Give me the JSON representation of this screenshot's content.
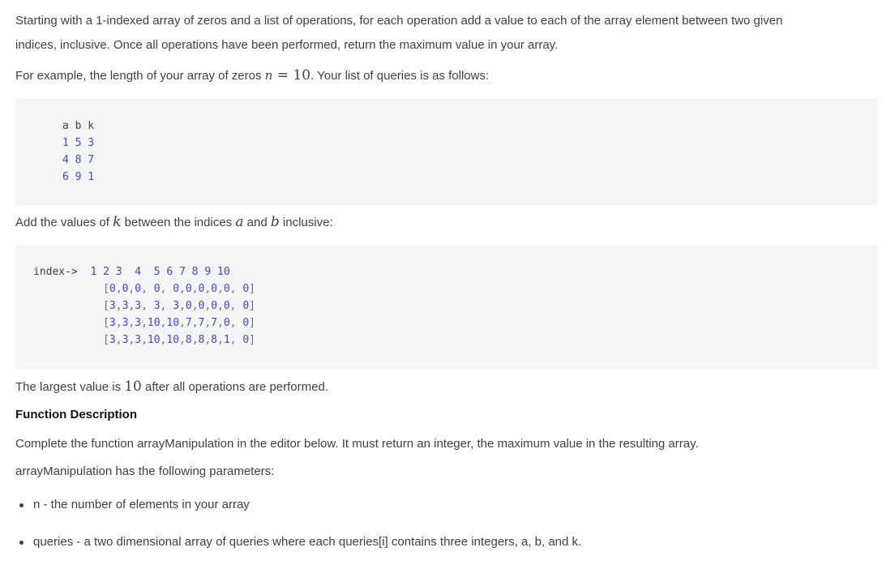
{
  "intro": {
    "line1": "Starting with a 1-indexed array of zeros and a list of operations, for each operation add a value to each of the array element between two given",
    "line2": "indices, inclusive. Once all operations have been performed, return the maximum value in your array.",
    "example_prefix": "For example, the length of your array of zeros ",
    "example_n": "n",
    "example_eq": " = ",
    "example_value": "10",
    "example_suffix": ". Your list of queries is as follows:"
  },
  "queries_block": {
    "header": "a b k",
    "rows": [
      "1 5 3",
      "4 8 7",
      "6 9 1"
    ]
  },
  "add_text": {
    "prefix": "Add the values of ",
    "k": "k",
    "mid": " between the indices ",
    "a": "a",
    "and": " and ",
    "b": "b",
    "suffix": " inclusive:"
  },
  "array_block": {
    "index_label": "index->",
    "index_values": "1 2 3  4  5 6 7 8 9 10",
    "rows": [
      "[0,0,0, 0, 0,0,0,0,0, 0]",
      "[3,3,3, 3, 3,0,0,0,0, 0]",
      "[3,3,3,10,10,7,7,7,0, 0]",
      "[3,3,3,10,10,8,8,8,1, 0]"
    ]
  },
  "largest": {
    "prefix": "The largest value is ",
    "value": "10",
    "suffix": " after all operations are performed."
  },
  "function_description": {
    "heading": "Function Description",
    "text": "Complete the function arrayManipulation in the editor below. It must return an integer, the maximum value in the resulting array.",
    "params_intro": "arrayManipulation has the following parameters:",
    "params": [
      "n - the number of elements in your array",
      "queries - a two dimensional array of queries where each queries[i] contains three integers, a, b, and k."
    ]
  }
}
